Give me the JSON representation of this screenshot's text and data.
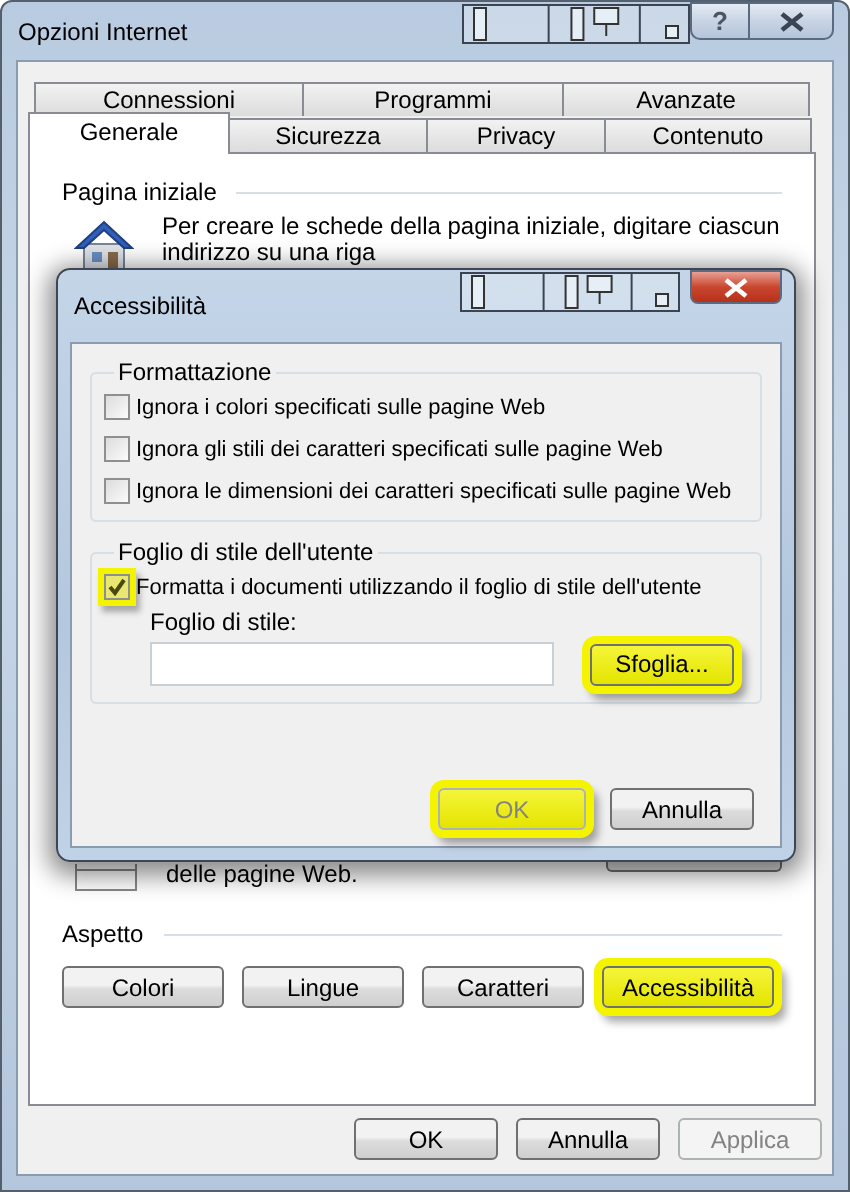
{
  "window": {
    "title": "Opzioni Internet",
    "help_label": "?"
  },
  "tab_rows": [
    [
      {
        "label": "Connessioni",
        "selected": false
      },
      {
        "label": "Programmi",
        "selected": false
      },
      {
        "label": "Avanzate",
        "selected": false
      }
    ],
    [
      {
        "label": "Generale",
        "selected": true
      },
      {
        "label": "Sicurezza",
        "selected": false
      },
      {
        "label": "Privacy",
        "selected": false
      },
      {
        "label": "Contenuto",
        "selected": false
      }
    ]
  ],
  "home_page": {
    "heading": "Pagina iniziale",
    "lines": [
      "Per creare le schede della pagina iniziale, digitare ciascun",
      "indirizzo su una riga"
    ]
  },
  "history": {
    "text": "delle pagine Web."
  },
  "appearance": {
    "heading": "Aspetto",
    "buttons": [
      {
        "label": "Colori",
        "highlighted": false
      },
      {
        "label": "Lingue",
        "highlighted": false
      },
      {
        "label": "Caratteri",
        "highlighted": false
      },
      {
        "label": "Accessibilità",
        "highlighted": true
      }
    ]
  },
  "footer_buttons": [
    {
      "label": "OK",
      "disabled": false
    },
    {
      "label": "Annulla",
      "disabled": false
    },
    {
      "label": "Applica",
      "disabled": true
    }
  ],
  "dialog": {
    "title": "Accessibilità",
    "formatting": {
      "heading": "Formattazione",
      "options": [
        {
          "label": "Ignora i colori specificati sulle pagine Web",
          "checked": false,
          "highlighted": false
        },
        {
          "label": "Ignora gli stili dei caratteri specificati sulle pagine Web",
          "checked": false,
          "highlighted": false
        },
        {
          "label": "Ignora le dimensioni dei caratteri specificati sulle pagine Web",
          "checked": false,
          "highlighted": false
        }
      ]
    },
    "user_style": {
      "heading": "Foglio di stile dell'utente",
      "option": {
        "label": "Formatta i documenti utilizzando il foglio di stile dell'utente",
        "checked": true,
        "highlighted": true
      },
      "field_label": "Foglio di stile:",
      "browse": {
        "label": "Sfoglia...",
        "highlighted": true
      }
    },
    "buttons": [
      {
        "label": "OK",
        "disabled": true,
        "highlighted": true
      },
      {
        "label": "Annulla",
        "disabled": false,
        "highlighted": false
      }
    ]
  }
}
